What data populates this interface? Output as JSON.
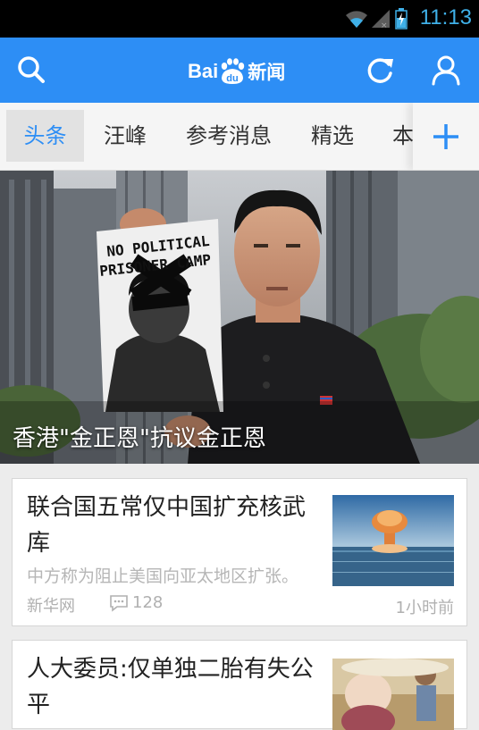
{
  "status_bar": {
    "time": "11:13",
    "icons": [
      "wifi-icon",
      "signal-icon",
      "battery-charging-icon"
    ],
    "accent": "#3fb0e8"
  },
  "header": {
    "logo_text": "Bai",
    "logo_badge": "du",
    "logo_suffix": "新闻",
    "icons": [
      "search-icon",
      "refresh-icon",
      "user-icon"
    ],
    "color": "#2d8ef5"
  },
  "tabs": {
    "items": [
      {
        "label": "头条",
        "active": true
      },
      {
        "label": "汪峰",
        "active": false
      },
      {
        "label": "参考消息",
        "active": false
      },
      {
        "label": "精选",
        "active": false
      },
      {
        "label": "本",
        "active": false
      }
    ],
    "add_icon": "plus-icon"
  },
  "hero": {
    "caption": "香港\"金正恩\"抗议金正恩",
    "sign_line1": "NO POLITICAL",
    "sign_line2": "PRISONER CAMP"
  },
  "news": [
    {
      "title": "联合国五常仅中国扩充核武库",
      "summary": "中方称为阻止美国向亚太地区扩张。",
      "source": "新华网",
      "comments": "128",
      "time": "1小时前",
      "thumb": "mushroom-cloud-city"
    },
    {
      "title": "人大委员:仅单独二胎有失公平",
      "summary": "",
      "source": "",
      "comments": "",
      "time": "",
      "thumb": "pregnant-woman-with-child"
    }
  ]
}
